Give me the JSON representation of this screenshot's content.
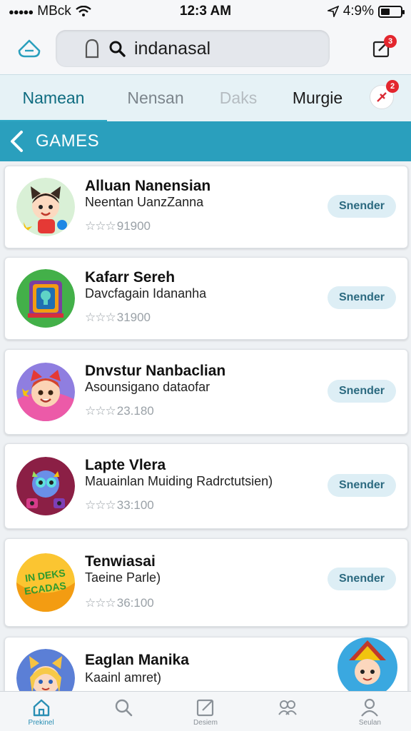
{
  "status_bar": {
    "carrier": "MBck",
    "time": "12:3 AM",
    "battery": "4:9%"
  },
  "search": {
    "query": "indanasal",
    "edit_badge": "3"
  },
  "tabs": [
    {
      "label": "Namean"
    },
    {
      "label": "Nensan"
    },
    {
      "label": "Daks"
    },
    {
      "label": "Murgie"
    }
  ],
  "tab_pin_badge": "2",
  "section": {
    "title": "GAMES"
  },
  "apps": [
    {
      "name": "Alluan Nanensian",
      "desc": "Neentan UanzZanna",
      "stars": "☆☆☆",
      "rating": "91900",
      "action": "Snender"
    },
    {
      "name": "Kafarr Sereh",
      "desc": "Davcfagain Idananha",
      "stars": "☆☆☆",
      "rating": "31900",
      "action": "Snender"
    },
    {
      "name": "Dnvstur Nanbaclian",
      "desc": "Asounsigano dataofar",
      "stars": "☆☆☆",
      "rating": "23.180",
      "action": "Snender"
    },
    {
      "name": "Lapte Vlera",
      "desc": "Mauainlan Muiding Radrctutsien)",
      "stars": "☆☆☆",
      "rating": "33:100",
      "action": "Snender"
    },
    {
      "name": "Tenwiasai",
      "desc": "Taeine Parle)",
      "stars": "☆☆☆",
      "rating": "36:100",
      "action": "Snender"
    },
    {
      "name": "Eaglan Manika",
      "desc": "Kaainl amret)"
    }
  ],
  "icon_texts": {
    "app5_line1": "IN DEKS",
    "app5_line2": "ECADAS"
  },
  "bottom_nav": [
    {
      "label": "Prekinel"
    },
    {
      "label": ""
    },
    {
      "label": "Desiem"
    },
    {
      "label": ""
    },
    {
      "label": "Seulan"
    }
  ],
  "colors": {
    "accent": "#2a9fbd",
    "tab_active": "#0f6c80",
    "badge": "#e3262e",
    "action_bg": "#ddeef5"
  }
}
